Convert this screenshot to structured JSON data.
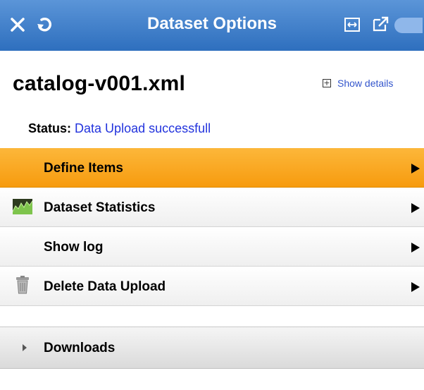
{
  "header": {
    "title": "Dataset Options",
    "icons": [
      "close-icon",
      "refresh-icon",
      "expand-icon",
      "share-icon"
    ],
    "colors": {
      "bar_top": "#5b95d8",
      "bar_bottom": "#2e6fbe"
    }
  },
  "dataset": {
    "filename": "catalog-v001.xml",
    "show_details_label": "Show details",
    "status_label": "Status:",
    "status_value": "Data Upload successfull"
  },
  "menu": {
    "items": [
      {
        "label": "Define Items",
        "active": true,
        "icon": ""
      },
      {
        "label": "Dataset Statistics",
        "active": false,
        "icon": "chart-icon"
      },
      {
        "label": "Show log",
        "active": false,
        "icon": ""
      },
      {
        "label": "Delete Data Upload",
        "active": false,
        "icon": "trash-icon"
      }
    ],
    "active_color": "#f7a21a"
  },
  "downloads": {
    "label": "Downloads",
    "icon": "collapsed-triangle-icon"
  }
}
